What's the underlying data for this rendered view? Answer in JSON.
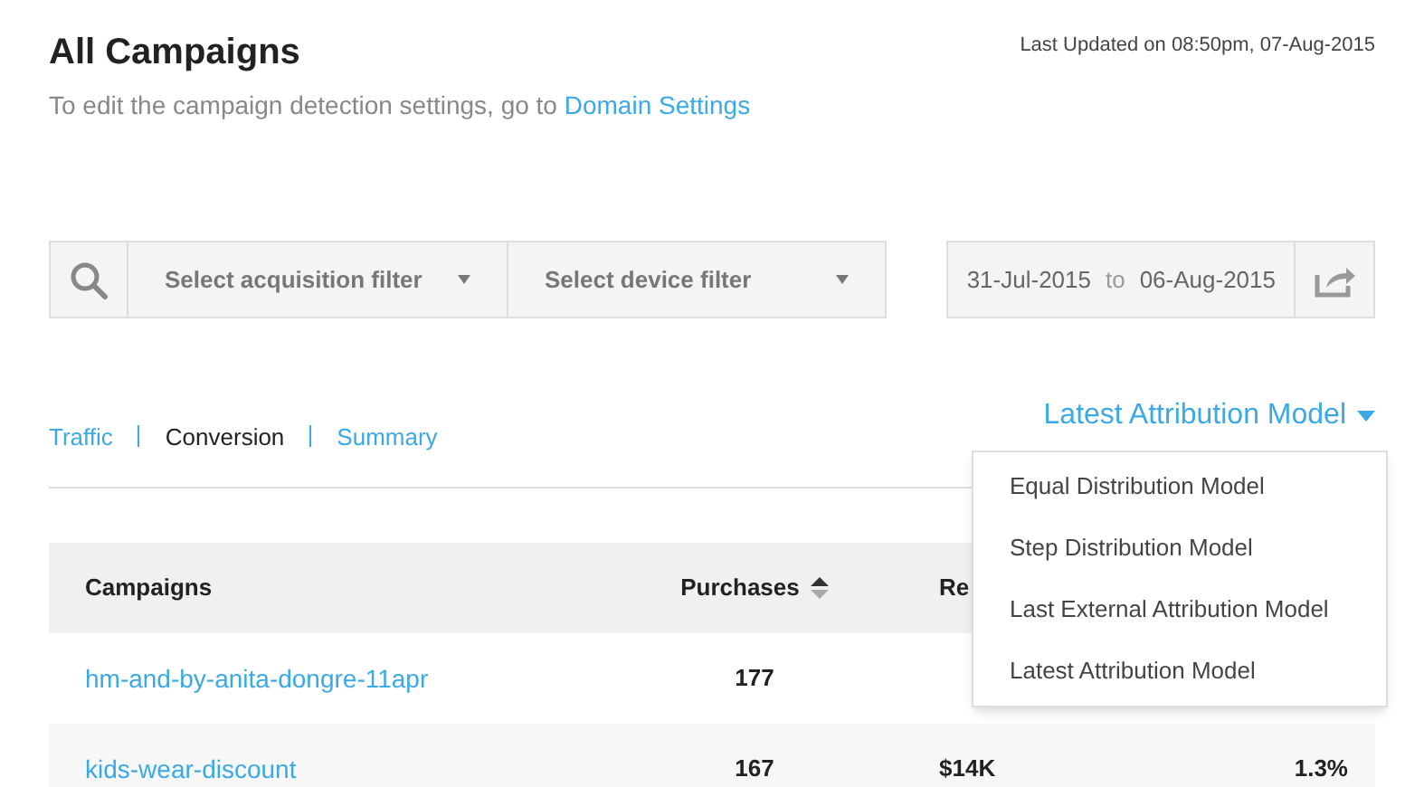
{
  "header": {
    "title": "All Campaigns",
    "last_updated": "Last Updated on 08:50pm, 07-Aug-2015",
    "hint": "To edit the campaign detection settings, go to",
    "hint_link": "Domain Settings"
  },
  "filters": {
    "acquisition": {
      "placeholder": "Select acquisition filter"
    },
    "device": {
      "placeholder": "Select device filter"
    },
    "date_from": "31-Jul-2015",
    "date_sep": "to",
    "date_to": "06-Aug-2015"
  },
  "tabs": [
    {
      "label": "Traffic",
      "selected": false
    },
    {
      "label": "Conversion",
      "selected": true
    },
    {
      "label": "Summary",
      "selected": false
    }
  ],
  "model_dropdown": {
    "value": "Latest Attribution Model",
    "expanded": true,
    "options": [
      "Equal Distribution Model",
      "Step Distribution Model",
      "Last External Attribution Model",
      "Latest Attribution Model"
    ]
  },
  "table": {
    "columns": [
      "Campaigns",
      "Purchases",
      "Re"
    ],
    "rows": [
      {
        "campaign": "hm-and-by-anita-dongre-11apr",
        "purchases": "177"
      },
      {
        "campaign": "kids-wear-discount",
        "purchases": "167",
        "column_3": "$14K",
        "column_4": "1.3%"
      }
    ]
  }
}
